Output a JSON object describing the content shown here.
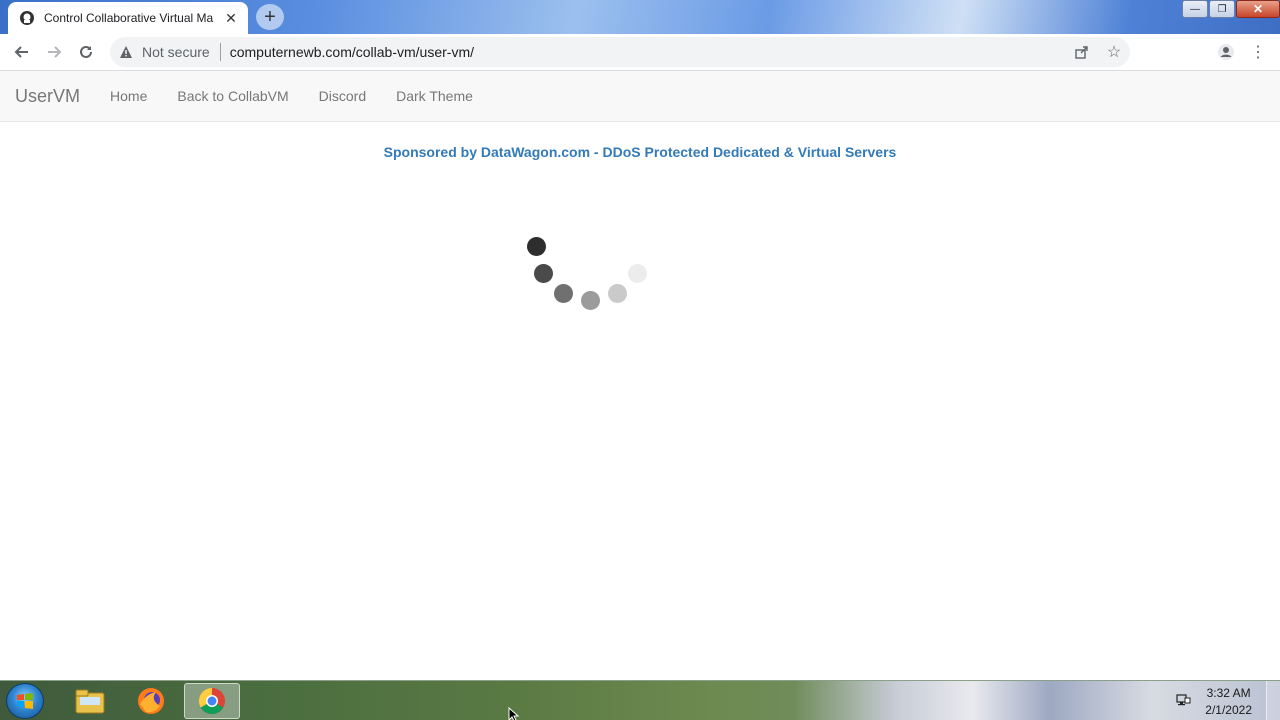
{
  "browser": {
    "tab_title": "Control Collaborative Virtual Ma",
    "security_label": "Not secure",
    "url": "computernewb.com/collab-vm/user-vm/"
  },
  "navbar": {
    "brand": "UserVM",
    "links": [
      "Home",
      "Back to CollabVM",
      "Discord",
      "Dark Theme"
    ]
  },
  "sponsor": {
    "prefix": "Sponsored by DataWagon.com - DDoS Protected Dedicated & Virtual Servers"
  },
  "taskbar": {
    "apps": [
      "start-orb",
      "file-explorer-icon",
      "firefox-icon",
      "chrome-icon"
    ],
    "time": "3:32 AM",
    "date": "2/1/2022"
  },
  "colors": {
    "link": "#337ab7",
    "nav_text": "#777777"
  }
}
